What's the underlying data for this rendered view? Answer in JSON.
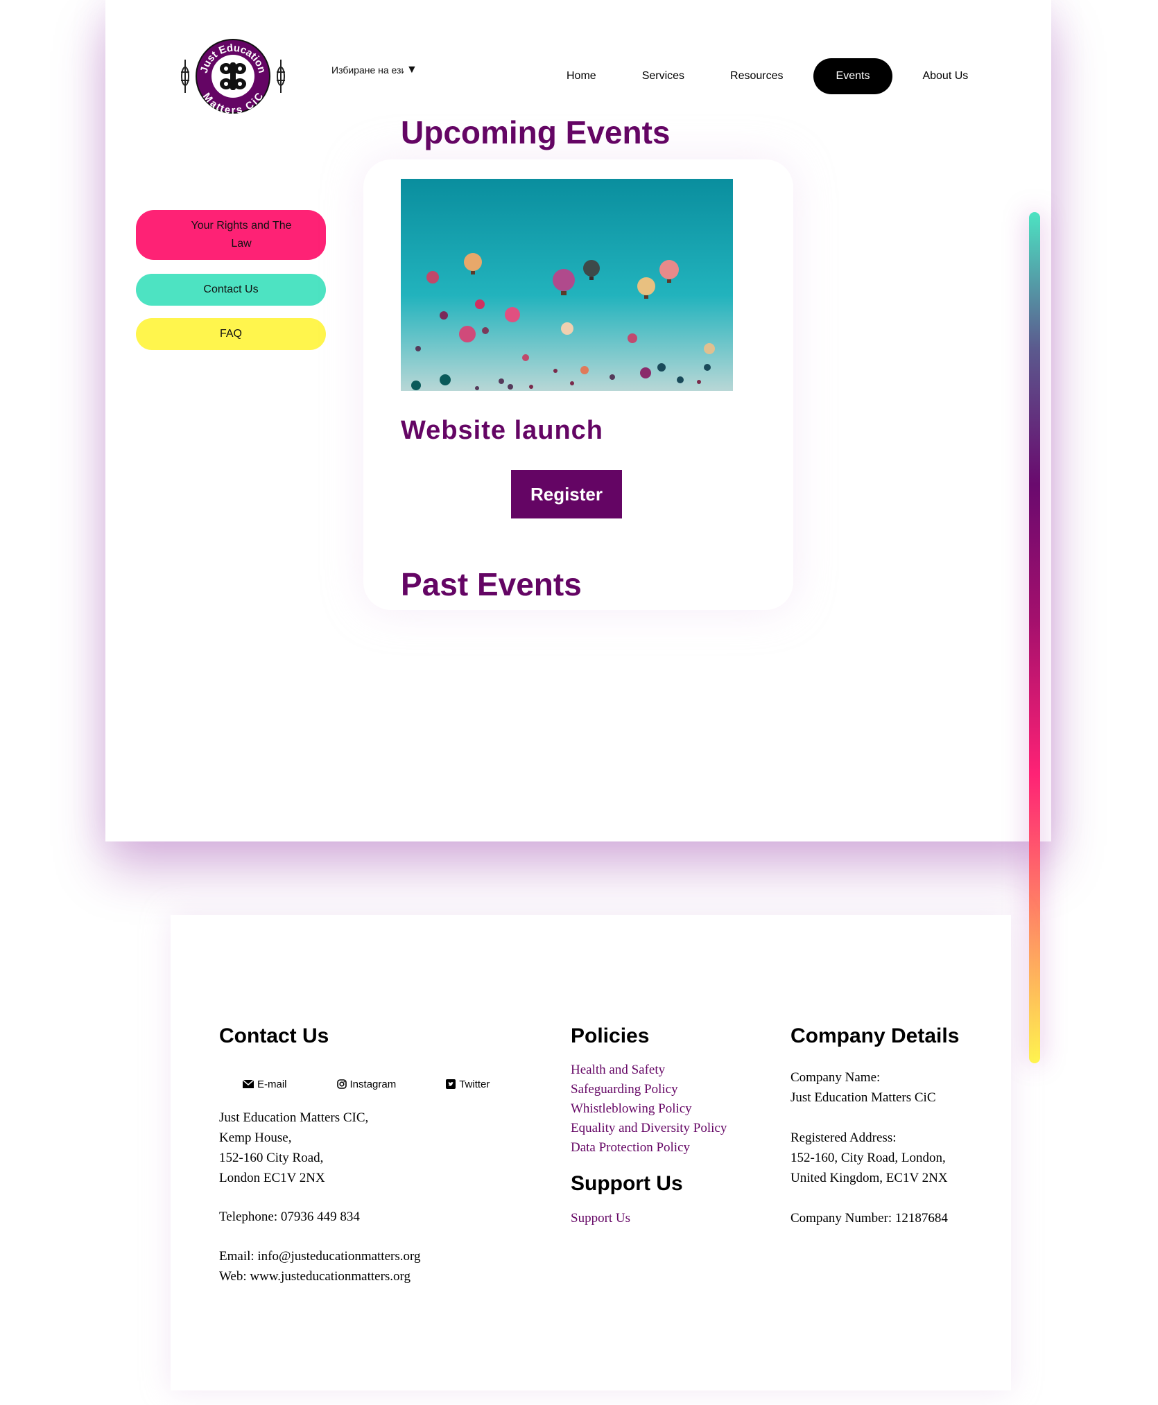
{
  "header": {
    "logo_text_top": "Just Education",
    "logo_text_bottom": "Matters CiC",
    "language_select": "Избиране на език",
    "language_arrow": "▼",
    "nav": [
      {
        "label": "Home",
        "active": false
      },
      {
        "label": "Services",
        "active": false
      },
      {
        "label": "Resources",
        "active": false
      },
      {
        "label": "Events",
        "active": true
      },
      {
        "label": "About Us",
        "active": false
      }
    ]
  },
  "sidebar": {
    "items": [
      {
        "label": "Your Rights and The Law",
        "color": "#fe2275"
      },
      {
        "label": "Contact Us",
        "color": "#4de3c2"
      },
      {
        "label": "FAQ",
        "color": "#fff54d"
      }
    ]
  },
  "main": {
    "upcoming_title": "Upcoming Events",
    "event": {
      "image_icon": "hot-air-balloons-image",
      "title": "Website launch",
      "register_label": "Register"
    },
    "past_title": "Past Events"
  },
  "footer": {
    "contact": {
      "heading": "Contact Us",
      "social": [
        {
          "label": "E-mail",
          "icon": "envelope-icon"
        },
        {
          "label": "Instagram",
          "icon": "instagram-icon"
        },
        {
          "label": "Twitter",
          "icon": "twitter-icon"
        }
      ],
      "address": [
        "Just Education Matters CIC,",
        "Kemp House,",
        "152-160 City Road,",
        "London EC1V 2NX"
      ],
      "telephone": "Telephone: 07936 449 834",
      "email": "Email: info@justeducationmatters.org",
      "web": "Web: www.justeducationmatters.org"
    },
    "policies": {
      "heading": "Policies",
      "links": [
        "Health and Safety",
        "Safeguarding Policy",
        "Whistleblowing Policy",
        "Equality and Diversity Policy",
        "Data Protection Policy"
      ]
    },
    "support": {
      "heading": "Support Us",
      "link": "Support Us"
    },
    "company": {
      "heading": "Company Details",
      "name_label": "Company Name:",
      "name_value": "Just Education Matters CiC",
      "address_label": "Registered Address:",
      "address_line1": "152-160, City Road, London,",
      "address_line2": "United Kingdom, EC1V 2NX",
      "number": "Company Number: 12187684"
    }
  },
  "colors": {
    "brand_purple": "#640564",
    "pink": "#fe2275",
    "teal": "#4de3c2",
    "yellow": "#fff54d"
  }
}
